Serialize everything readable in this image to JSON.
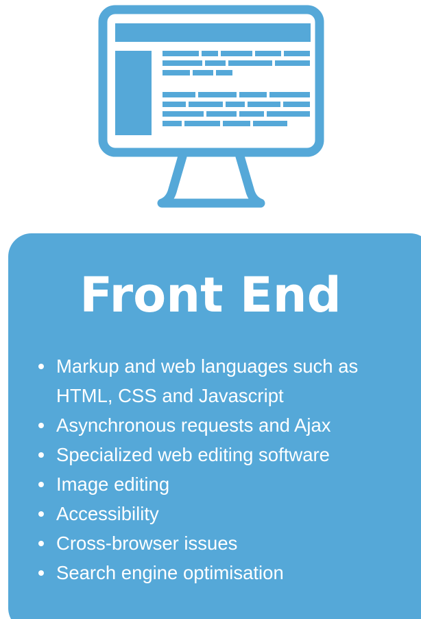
{
  "colors": {
    "accent": "#55a8d8",
    "text": "#ffffff",
    "background": "#ffffff"
  },
  "icon": "desktop-monitor-webpage-icon",
  "card": {
    "title": "Front End",
    "items": [
      "Markup and web languages such as HTML, CSS and Javascript",
      "Asynchronous requests and Ajax",
      "Specialized web editing software",
      "Image editing",
      "Accessibility",
      "Cross-browser issues",
      "Search engine optimisation"
    ]
  }
}
